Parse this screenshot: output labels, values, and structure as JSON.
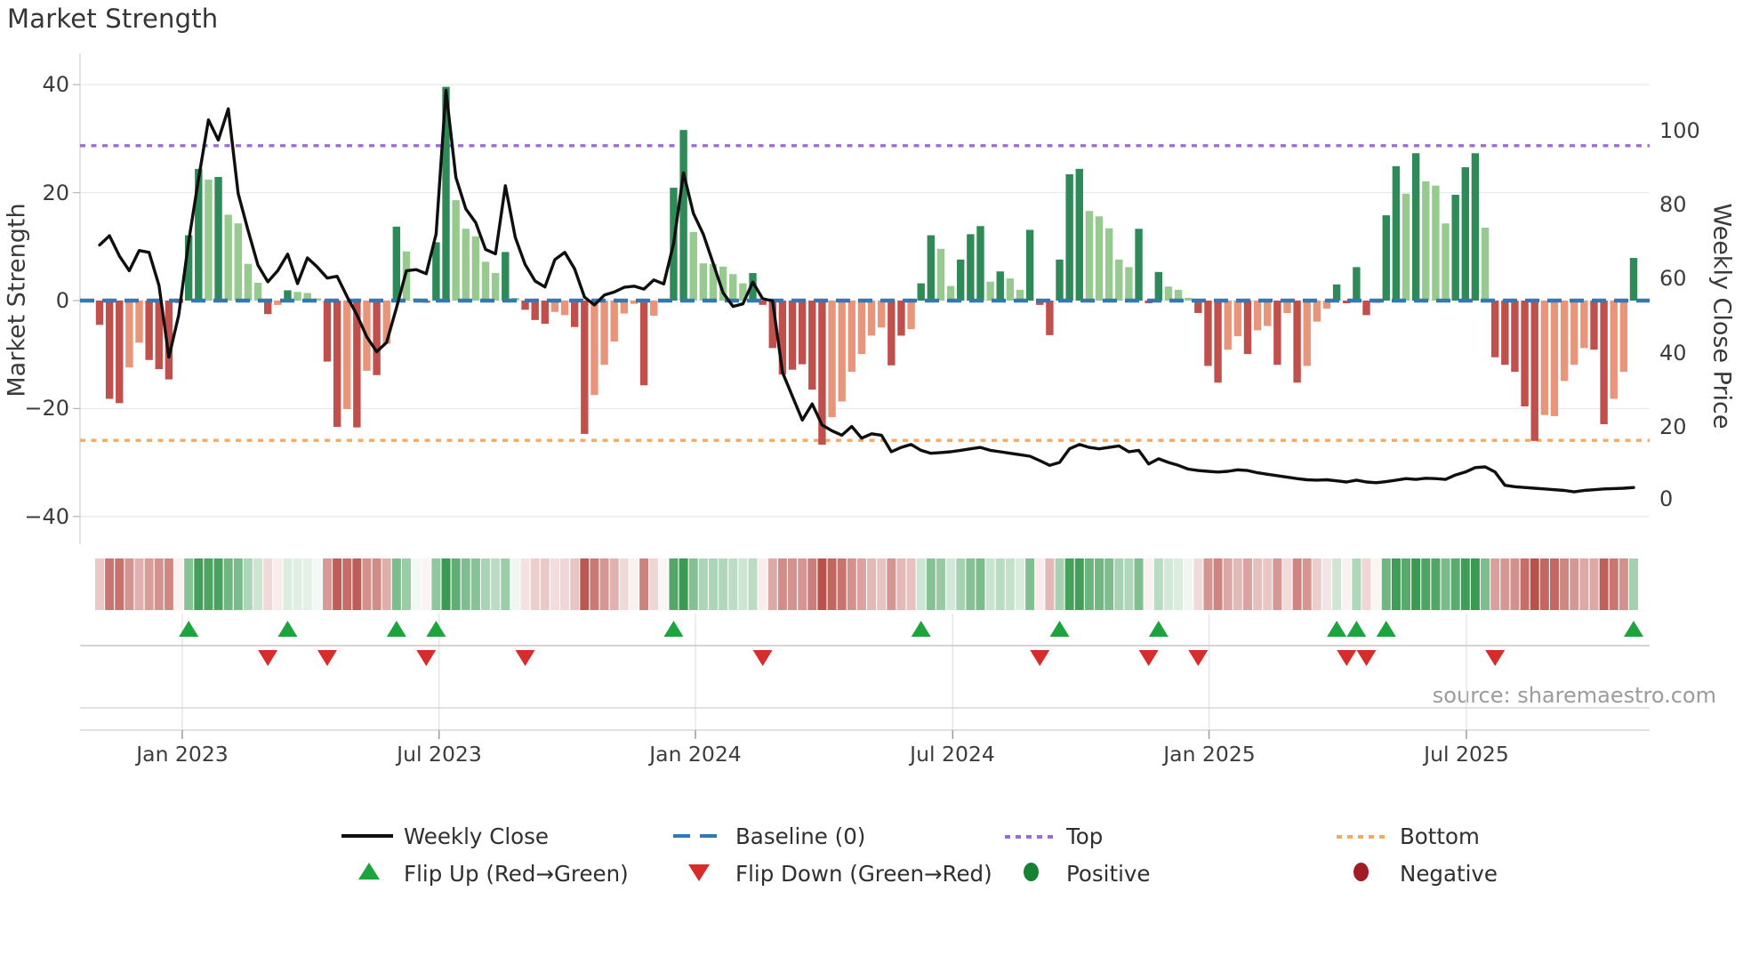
{
  "title": "Market Strength",
  "source": "source: sharemaestro.com",
  "axes": {
    "left_label": "Market Strength",
    "right_label": "Weekly Close Price",
    "left_ticks": [
      "40",
      "20",
      "0",
      "−20",
      "−40"
    ],
    "right_ticks": [
      "100",
      "80",
      "60",
      "40",
      "20",
      "0"
    ],
    "x_ticks": [
      {
        "label": "Jan 2023",
        "week": 8.35
      },
      {
        "label": "Jul 2023",
        "week": 34.3
      },
      {
        "label": "Jan 2024",
        "week": 60.2
      },
      {
        "label": "Jul 2024",
        "week": 86.2
      },
      {
        "label": "Jan 2025",
        "week": 112.1
      },
      {
        "label": "Jul 2025",
        "week": 138.1
      }
    ]
  },
  "legend": {
    "weekly_close": "Weekly Close",
    "baseline": "Baseline (0)",
    "top": "Top",
    "bottom": "Bottom",
    "flip_up": "Flip Up (Red→Green)",
    "flip_down": "Flip Down (Green→Red)",
    "positive": "Positive",
    "negative": "Negative"
  },
  "colors": {
    "bar_dark_green": "#2e8b57",
    "bar_light_green": "#97ca8f",
    "bar_dark_red": "#c1504c",
    "bar_light_red": "#e8957b",
    "price_line": "#0f0f0f",
    "baseline": "#3179b5",
    "top_line": "#9b6cd6",
    "bottom_line": "#f3a963",
    "flip_up_marker": "#1ea43c",
    "flip_down_marker": "#d62c2c",
    "positive_dot": "#168233",
    "negative_dot": "#a01d24",
    "grid": "#e9ebee",
    "heat_green": "#3a9a52",
    "heat_red": "#ba524c"
  },
  "chart_data": {
    "type": "bar-line-combo-with-heatmap",
    "title": "Market Strength",
    "frequency": "weekly",
    "start_date": "2022-11-07",
    "left_axis": {
      "label": "Market Strength",
      "range": [
        -40,
        40
      ],
      "grid": true
    },
    "right_axis": {
      "label": "Weekly Close Price",
      "range": [
        0,
        100
      ]
    },
    "baseline_value": 0,
    "top_line_value": 28.7,
    "bottom_line_value": -25.9,
    "weeks_format": [
      "market_strength_bar",
      "bar_color_class(dg=dark-green,lg=light-green,dr=dark-red,lr=light-red)",
      "weekly_close_price"
    ],
    "weeks": [
      [
        -4.5,
        "dr",
        69
      ],
      [
        -18.2,
        "dr",
        71.5
      ],
      [
        -19,
        "dr",
        66
      ],
      [
        -12.4,
        "lr",
        62
      ],
      [
        -7.8,
        "lr",
        67.5
      ],
      [
        -11,
        "dr",
        67
      ],
      [
        -12.7,
        "dr",
        58
      ],
      [
        -14.6,
        "dr",
        38.5
      ],
      [
        -0.5,
        "lr",
        50
      ],
      [
        12.1,
        "dg",
        70
      ],
      [
        24.4,
        "dg",
        87
      ],
      [
        22.4,
        "lg",
        103
      ],
      [
        22.9,
        "dg",
        97.5
      ],
      [
        15.9,
        "lg",
        106
      ],
      [
        14.3,
        "lg",
        83
      ],
      [
        6.8,
        "lg",
        73
      ],
      [
        3.3,
        "lg",
        63.5
      ],
      [
        -2.5,
        "dr",
        59
      ],
      [
        -0.8,
        "lr",
        62
      ],
      [
        1.9,
        "dg",
        66.5
      ],
      [
        1.6,
        "lg",
        58.5
      ],
      [
        1.4,
        "lg",
        65.5
      ],
      [
        0.4,
        "lg",
        63
      ],
      [
        -11.3,
        "dr",
        60
      ],
      [
        -23.4,
        "dr",
        60.5
      ],
      [
        -20.1,
        "lr",
        55
      ],
      [
        -23.5,
        "dr",
        50
      ],
      [
        -13,
        "lr",
        44
      ],
      [
        -13.8,
        "dr",
        40
      ],
      [
        -8,
        "lr",
        42.5
      ],
      [
        13.7,
        "dg",
        52
      ],
      [
        9.1,
        "lg",
        62
      ],
      [
        0.4,
        "lg",
        62.3
      ],
      [
        -0.4,
        "dr",
        61.2
      ],
      [
        10.8,
        "dg",
        72
      ],
      [
        39.6,
        "dg",
        111
      ],
      [
        18.6,
        "lg",
        87.4
      ],
      [
        13.3,
        "lg",
        78.8
      ],
      [
        11.9,
        "lg",
        75.1
      ],
      [
        7.2,
        "lg",
        67.8
      ],
      [
        5.1,
        "lg",
        66.6
      ],
      [
        9,
        "dg",
        85.1
      ],
      [
        0.5,
        "lg",
        71.1
      ],
      [
        -1.7,
        "dr",
        63.7
      ],
      [
        -3.6,
        "dr",
        59.2
      ],
      [
        -4.3,
        "dr",
        57.6
      ],
      [
        -2.1,
        "lr",
        65
      ],
      [
        -2.7,
        "lr",
        67
      ],
      [
        -4.9,
        "dr",
        62.5
      ],
      [
        -24.7,
        "dr",
        54.8
      ],
      [
        -17.5,
        "lr",
        52.7
      ],
      [
        -11.9,
        "lr",
        55.4
      ],
      [
        -7.6,
        "lr",
        56.2
      ],
      [
        -2.4,
        "lr",
        57.5
      ],
      [
        -0.6,
        "lr",
        57.8
      ],
      [
        -15.7,
        "dr",
        57
      ],
      [
        -2.8,
        "lr",
        59.5
      ],
      [
        -0.3,
        "lr",
        58.4
      ],
      [
        20.9,
        "dg",
        69.4
      ],
      [
        31.6,
        "dg",
        88.6
      ],
      [
        12.7,
        "lg",
        77.6
      ],
      [
        6.9,
        "lg",
        71.9
      ],
      [
        6.8,
        "lg",
        64
      ],
      [
        6.3,
        "lg",
        56
      ],
      [
        4.9,
        "lg",
        52.3
      ],
      [
        3.2,
        "lg",
        53
      ],
      [
        5.1,
        "dg",
        58.9
      ],
      [
        -0.8,
        "dr",
        54.4
      ],
      [
        -8.8,
        "dr",
        53.8
      ],
      [
        -13.7,
        "dr",
        34.4
      ],
      [
        -12.8,
        "dr",
        27.9
      ],
      [
        -11.8,
        "dr",
        21.4
      ],
      [
        -16.5,
        "dr",
        25.8
      ],
      [
        -26.7,
        "dr",
        20.1
      ],
      [
        -21.6,
        "lr",
        18.5
      ],
      [
        -18.7,
        "lr",
        17.3
      ],
      [
        -13.2,
        "lr",
        19.7
      ],
      [
        -9.9,
        "lr",
        16.5
      ],
      [
        -6.5,
        "lr",
        17.7
      ],
      [
        -5,
        "lr",
        17.3
      ],
      [
        -12,
        "dr",
        12.8
      ],
      [
        -6.5,
        "dr",
        14
      ],
      [
        -5.3,
        "lr",
        14.8
      ],
      [
        3.2,
        "dg",
        13.2
      ],
      [
        12.1,
        "dg",
        12.4
      ],
      [
        9.6,
        "lg",
        12.6
      ],
      [
        2.7,
        "lg",
        12.8
      ],
      [
        7.6,
        "dg",
        13.2
      ],
      [
        12.3,
        "dg",
        13.6
      ],
      [
        13.8,
        "dg",
        14
      ],
      [
        3.5,
        "lg",
        13.2
      ],
      [
        5.4,
        "dg",
        12.8
      ],
      [
        4.1,
        "lg",
        12.4
      ],
      [
        2,
        "lg",
        12
      ],
      [
        13.1,
        "dg",
        11.6
      ],
      [
        -0.8,
        "dr",
        10.4
      ],
      [
        -6.4,
        "dr",
        9.1
      ],
      [
        7.6,
        "dg",
        9.9
      ],
      [
        23.4,
        "dg",
        13.6
      ],
      [
        24.4,
        "dg",
        14.8
      ],
      [
        16.6,
        "lg",
        14
      ],
      [
        15.6,
        "lg",
        13.6
      ],
      [
        13.4,
        "lg",
        14
      ],
      [
        7.6,
        "lg",
        14.4
      ],
      [
        6.2,
        "lg",
        12.8
      ],
      [
        13.3,
        "dg",
        13.2
      ],
      [
        -0.5,
        "dr",
        9.5
      ],
      [
        5.3,
        "dg",
        10.9
      ],
      [
        2.6,
        "lg",
        9.9
      ],
      [
        2,
        "lg",
        9.1
      ],
      [
        0.5,
        "lg",
        8.1
      ],
      [
        -2.3,
        "dr",
        7.7
      ],
      [
        -12.1,
        "dr",
        7.5
      ],
      [
        -15.2,
        "dr",
        7.3
      ],
      [
        -9.1,
        "lr",
        7.5
      ],
      [
        -6.6,
        "lr",
        7.9
      ],
      [
        -9.9,
        "dr",
        7.7
      ],
      [
        -5.5,
        "lr",
        7.1
      ],
      [
        -4.7,
        "lr",
        6.7
      ],
      [
        -11.9,
        "dr",
        6.3
      ],
      [
        -2.3,
        "lr",
        5.9
      ],
      [
        -15.2,
        "dr",
        5.5
      ],
      [
        -12.1,
        "lr",
        5.2
      ],
      [
        -3.9,
        "lr",
        5.1
      ],
      [
        -1.5,
        "lr",
        5.2
      ],
      [
        3,
        "dg",
        4.9
      ],
      [
        -0.5,
        "dr",
        4.6
      ],
      [
        6.2,
        "dg",
        5.1
      ],
      [
        -2.7,
        "dr",
        4.6
      ],
      [
        -0.4,
        "dr",
        4.4
      ],
      [
        15.8,
        "dg",
        4.7
      ],
      [
        24.9,
        "dg",
        5.1
      ],
      [
        19.8,
        "lg",
        5.5
      ],
      [
        27.3,
        "dg",
        5.3
      ],
      [
        22.1,
        "lg",
        5.6
      ],
      [
        21.3,
        "lg",
        5.5
      ],
      [
        14.3,
        "lg",
        5.3
      ],
      [
        19.6,
        "dg",
        6.5
      ],
      [
        24.7,
        "dg",
        7.3
      ],
      [
        27.3,
        "dg",
        8.5
      ],
      [
        13.5,
        "lg",
        8.7
      ],
      [
        -10.5,
        "dr",
        7.3
      ],
      [
        -11.9,
        "dr",
        3.7
      ],
      [
        -13.2,
        "dr",
        3.3
      ],
      [
        -19.6,
        "dr",
        3.1
      ],
      [
        -26,
        "dr",
        2.9
      ],
      [
        -21.2,
        "lr",
        2.7
      ],
      [
        -21.4,
        "lr",
        2.5
      ],
      [
        -14.9,
        "lr",
        2.3
      ],
      [
        -11.9,
        "lr",
        1.9
      ],
      [
        -8.8,
        "lr",
        2.3
      ],
      [
        -9.1,
        "dr",
        2.5
      ],
      [
        -22.9,
        "dr",
        2.7
      ],
      [
        -18.2,
        "lr",
        2.8
      ],
      [
        -13.2,
        "lr",
        2.9
      ],
      [
        7.9,
        "dg",
        3.1
      ]
    ],
    "flip_up_weeks": [
      9,
      19,
      30,
      34,
      58,
      83,
      97,
      107,
      125,
      127,
      130,
      155
    ],
    "flip_down_weeks": [
      17,
      23,
      33,
      43,
      67,
      95,
      106,
      111,
      126,
      128,
      141
    ],
    "legend_entries": [
      "Weekly Close",
      "Baseline (0)",
      "Top",
      "Bottom",
      "Flip Up (Red→Green)",
      "Flip Down (Green→Red)",
      "Positive",
      "Negative"
    ],
    "legend_position": "bottom-center"
  }
}
